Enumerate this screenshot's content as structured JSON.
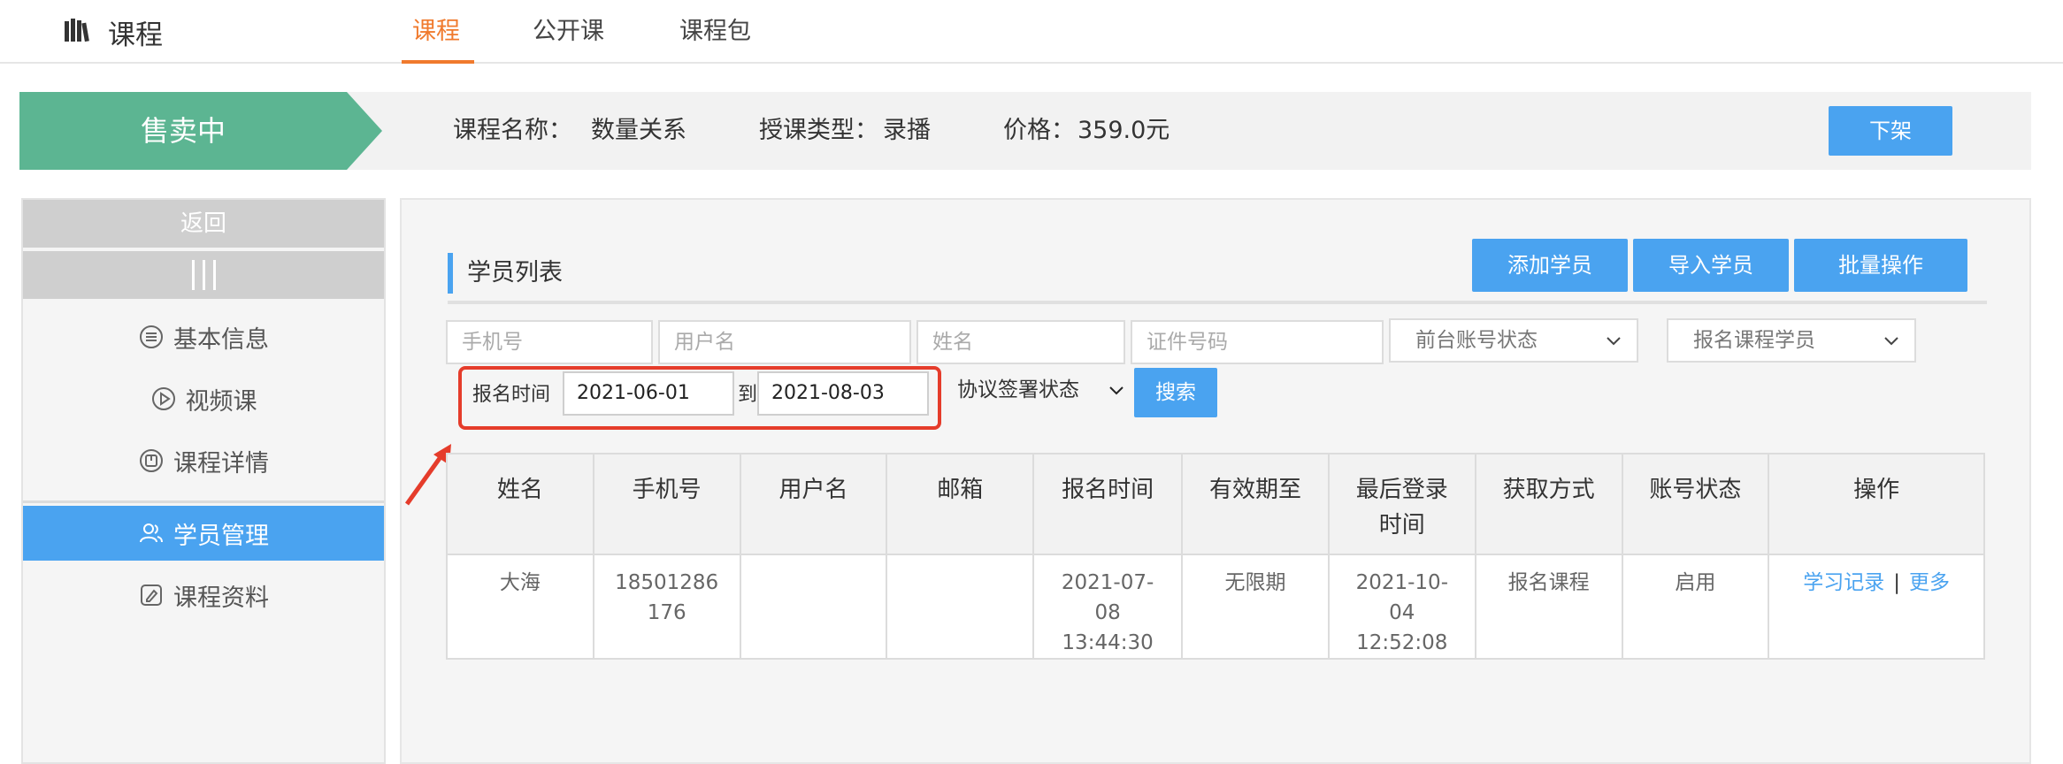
{
  "nav": {
    "brand": "课程",
    "tabs": [
      {
        "label": "课程",
        "active": true
      },
      {
        "label": "公开课",
        "active": false
      },
      {
        "label": "课程包",
        "active": false
      }
    ],
    "active_color": "#f07a2d"
  },
  "banner": {
    "status": "售卖中",
    "course_name_label": "课程名称：",
    "course_name": "数量关系",
    "type_label": "授课类型：",
    "type": "录播",
    "price_label": "价格：",
    "price": "359.0元",
    "unpublish_button": "下架"
  },
  "sidebar": {
    "back": "返回",
    "items": [
      {
        "label": "基本信息",
        "icon": "list-icon",
        "active": false
      },
      {
        "label": "视频课",
        "icon": "play-icon",
        "active": false
      },
      {
        "label": "课程详情",
        "icon": "book-icon",
        "active": false
      },
      {
        "label": "学员管理",
        "icon": "users-icon",
        "active": true
      },
      {
        "label": "课程资料",
        "icon": "edit-icon",
        "active": false
      }
    ]
  },
  "main": {
    "title": "学员列表",
    "actions": {
      "add": "添加学员",
      "import": "导入学员",
      "batch": "批量操作"
    },
    "filters": {
      "phone_placeholder": "手机号",
      "username_placeholder": "用户名",
      "name_placeholder": "姓名",
      "id_placeholder": "证件号码",
      "account_status": "前台账号状态",
      "enroll_type": "报名课程学员",
      "enroll_time_label": "报名时间",
      "date_from": "2021-06-01",
      "to_label": "到",
      "date_to": "2021-08-03",
      "agreement_status": "协议签署状态",
      "search_button": "搜索"
    },
    "table": {
      "headers": [
        "姓名",
        "手机号",
        "用户名",
        "邮箱",
        "报名时间",
        "有效期至",
        "最后登录时间",
        "获取方式",
        "账号状态",
        "操作"
      ],
      "rows": [
        {
          "name": "大海",
          "phone": "18501286176",
          "username": "",
          "email": "",
          "enroll_time": "2021-07-08 13:44:30",
          "valid_until": "无限期",
          "last_login": "2021-10-04 12:52:08",
          "source": "报名课程",
          "status": "启用",
          "op_record": "学习记录",
          "op_more": "更多"
        }
      ]
    }
  },
  "colors": {
    "accent": "#4aa3f0",
    "status_green": "#5cb592",
    "highlight_red": "#e53c2b"
  }
}
